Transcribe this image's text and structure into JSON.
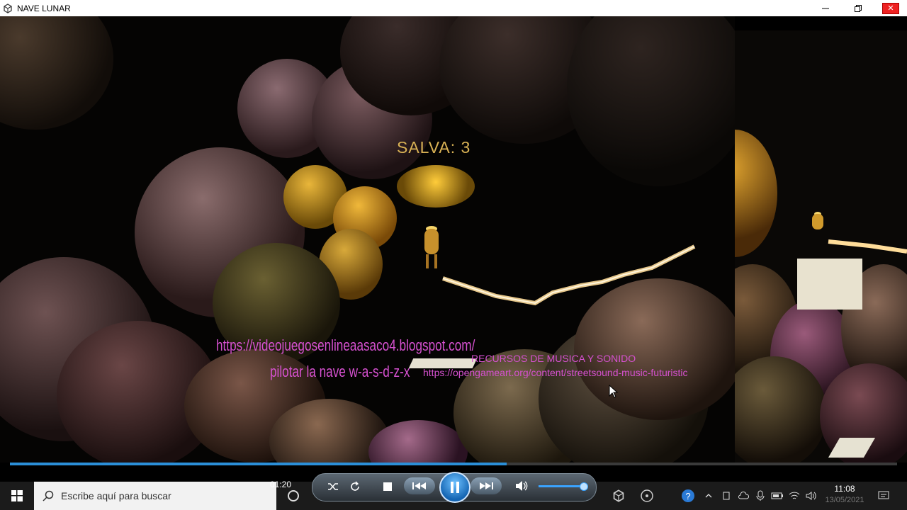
{
  "window": {
    "title": "NAVE LUNAR",
    "minimize_icon": "minimize-icon",
    "maximize_icon": "restore-icon",
    "close_icon": "close-icon"
  },
  "game": {
    "score_label": "SALVA: 3",
    "blog_link": "https://videojuegosenlineaasaco4.blogspot.com/",
    "controls_hint": "pilotar la nave w-a-s-d-z-x",
    "resources_title": "RECURSOS DE MUSICA Y SONIDO",
    "resources_link": "https://opengameart.org/content/streetsound-music-futuristic"
  },
  "player": {
    "elapsed_time": "01:20",
    "progress": 0.56,
    "volume": 0.92
  },
  "taskbar": {
    "search_placeholder": "Escribe aquí para buscar",
    "time": "11:08",
    "date": "13/05/2021"
  },
  "colors": {
    "hud_gold": "#d9b255",
    "hud_magenta": "#d651d0",
    "progress_blue": "#2b8fd8"
  }
}
